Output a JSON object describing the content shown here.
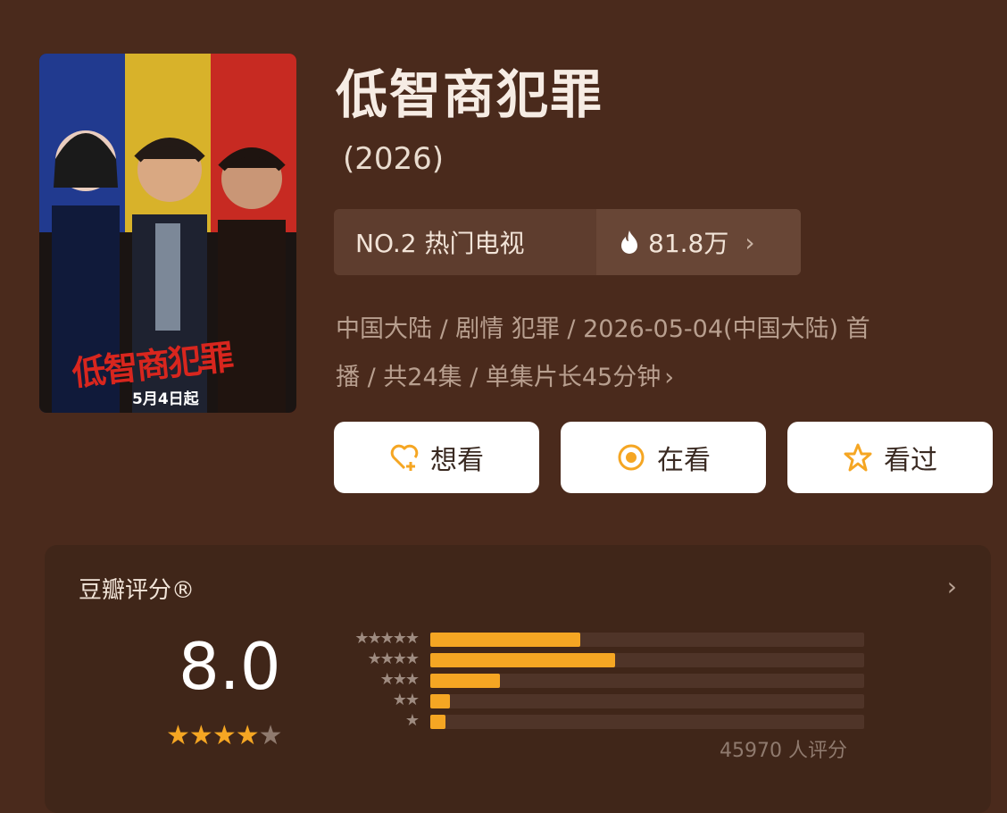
{
  "show": {
    "title": "低智商犯罪",
    "year": "(2026)",
    "poster": {
      "title_text": "低智商犯罪",
      "date_text": "5月4日起"
    }
  },
  "rank": {
    "label": "NO.2 热门电视",
    "heat": "81.8万",
    "icon": "fire-icon",
    "chevron": "›"
  },
  "meta": {
    "line1": "中国大陆 / 剧情 犯罪 / 2026-05-04(中国大陆) 首",
    "line2": "播 / 共24集 / 单集片长45分钟",
    "chevron": "›"
  },
  "actions": {
    "want": {
      "label": "想看",
      "icon": "heart-plus-icon"
    },
    "watching": {
      "label": "在看",
      "icon": "target-icon"
    },
    "watched": {
      "label": "看过",
      "icon": "star-outline-icon"
    }
  },
  "rating": {
    "title": "豆瓣评分®",
    "chevron": "›",
    "score": "8.0",
    "stars_filled": 4,
    "stars_total": 5,
    "distribution": [
      {
        "stars": 5,
        "fraction": 0.345
      },
      {
        "stars": 4,
        "fraction": 0.425
      },
      {
        "stars": 3,
        "fraction": 0.16
      },
      {
        "stars": 2,
        "fraction": 0.045
      },
      {
        "stars": 1,
        "fraction": 0.035
      }
    ],
    "count": "45970 人评分"
  },
  "colors": {
    "background": "#4a2a1c",
    "accent": "#f5a623",
    "card": "#402619"
  }
}
